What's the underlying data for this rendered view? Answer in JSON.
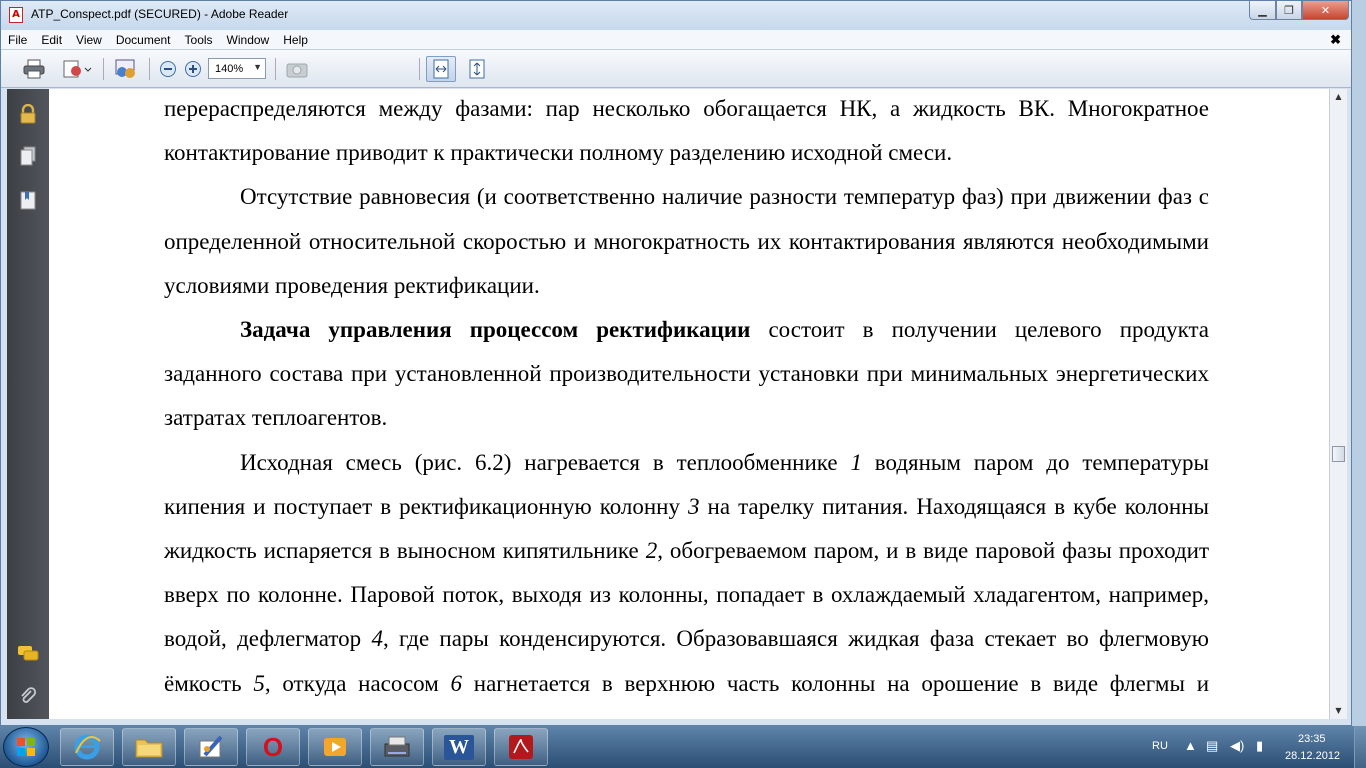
{
  "window": {
    "title": "ATP_Conspect.pdf (SECURED) - Adobe Reader",
    "app_icon_text": "A"
  },
  "menu": {
    "items": [
      "File",
      "Edit",
      "View",
      "Document",
      "Tools",
      "Window",
      "Help"
    ],
    "close_glyph": "✖"
  },
  "toolbar": {
    "zoom_value": "140%",
    "icons": [
      "print-icon",
      "share-icon",
      "collaborate-icon",
      "zoom-out-icon",
      "zoom-in-icon",
      "snapshot-icon",
      "fit-width-icon",
      "fit-page-icon"
    ]
  },
  "left_nav": {
    "icons": [
      "lock-icon",
      "pages-icon",
      "bookmarks-icon",
      "comments-icon",
      "attachments-icon"
    ]
  },
  "document": {
    "p1": "перераспределяются между фазами: пар несколько обогащается НК, а жидкость ВК. Многократное контактирование приводит к практически полному разделению исходной смеси.",
    "p2": "Отсутствие равновесия (и соответственно наличие разности температур фаз) при движении фаз с определенной относительной скоростью и многократность их контактирования являются необходимыми условиями проведения ректификации.",
    "p3_bold": "Задача управления процессом ректификации",
    "p3_rest": " состоит в получении целевого продукта заданного состава при установленной производительности установки при минимальных энергетических затратах теплоагентов.",
    "p4": {
      "t1": "Исходная смесь (рис. 6.2) нагревается в теплообменнике ",
      "n1": "1",
      "t2": " водяным паром до температуры кипения и поступает в ректификационную колонну ",
      "n3": "3",
      "t3": " на тарелку питания. Находящаяся в кубе колонны жидкость испаряется в выносном кипятильнике ",
      "n2": "2",
      "t4": ", обогреваемом паром, и в виде паровой фазы проходит вверх по колонне. Паровой поток, выходя из колонны, попадает в охлаждаемый хладагентом, например, водой, дефлегматор ",
      "n4": "4",
      "t5": ", где пары конденсируются. Образовавшаяся жидкая фаза стекает во флегмовую ёмкость ",
      "n5": "5",
      "t6": ", откуда насосом ",
      "n6": "6",
      "t7": " нагнетается в верхнюю часть колонны на орошение в виде флегмы и частично отводится с установки в виде дистиллята."
    }
  },
  "taskbar": {
    "apps": [
      "internet-explorer",
      "file-explorer",
      "paint",
      "opera",
      "media-player",
      "scanner",
      "word",
      "adobe-reader"
    ],
    "word_label": "W",
    "opera_label": "O",
    "lang": "RU",
    "time": "23:35",
    "date": "28.12.2012"
  }
}
